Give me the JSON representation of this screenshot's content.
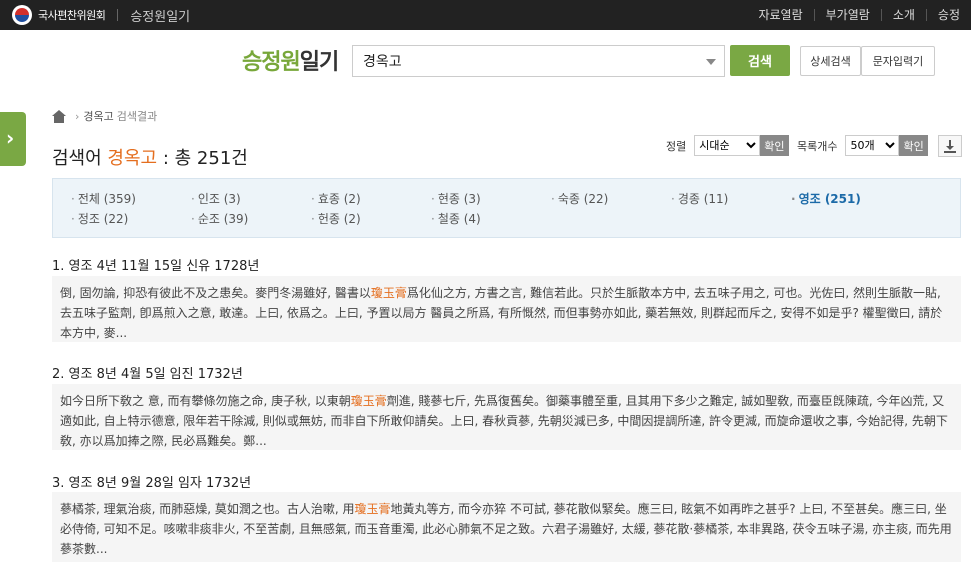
{
  "topbar": {
    "org": "국사편찬위원회",
    "app": "승정원일기",
    "links": [
      "자료열람",
      "부가열람",
      "소개",
      "승정"
    ]
  },
  "brand": {
    "green": "승정원",
    "dark": "일기"
  },
  "search": {
    "value": "경옥고",
    "button": "검색",
    "advanced": "상세검색",
    "char_input": "문자입력기"
  },
  "breadcrumb": {
    "keyword": "경옥고",
    "label": "검색결과"
  },
  "result_title": {
    "prefix": "검색어",
    "keyword": "경옥고",
    "suffix": ": 총 251건"
  },
  "controls": {
    "sort_label": "정렬",
    "sort_value": "시대순",
    "sort_ok": "확인",
    "count_label": "목록개수",
    "count_value": "50개",
    "count_ok": "확인"
  },
  "filters": [
    "전체 (359)",
    "인조 (3)",
    "효종 (2)",
    "현종 (3)",
    "숙종 (22)",
    "경종 (11)",
    "영조 (251)",
    "정조 (22)",
    "순조 (39)",
    "헌종 (2)",
    "철종 (4)"
  ],
  "results": [
    {
      "title": "1. 영조 4년 11월 15일  신유 1728년",
      "pre": "倒, 固勿論, 抑恐有彼此不及之患矣。麥門冬湯雖好, 醫書以",
      "kw": "瓊玉膏",
      "post": "爲化仙之方, 方書之言, 難信若此。只於生脈散本方中, 去五味子用之, 可也。光佐曰, 然則生脈散一貼, 去五味子監劑, 卽爲煎入之意, 敢達。上曰, 依爲之。上曰, 予置以局方 醫員之所爲, 有所慨然, 而但事勢亦如此, 藥若無效, 則群起而斥之, 安得不如是乎? 權聖徵曰, 請於本方中, 麥..."
    },
    {
      "title": "2. 영조 8년 4월 5일  임진 1732년",
      "pre": "如今日所下敎之 意, 而有攀條勿施之命, 庚子秋, 以東朝",
      "kw": "瓊玉膏",
      "post": "劑進, 賤蔘七斤, 先爲復舊矣。御藥事體至重, 且其用下多少之難定, 誠如聖敎, 而臺臣旣陳疏, 今年凶荒, 又適如此, 自上特示德意, 限年若干除減, 則似或無妨, 而非自下所敢仰請矣。上曰, 春秋貢蔘, 先朝災減已多, 中間因提調所達, 許令更減, 而旋命還收之事, 今始記得, 先朝下敎, 亦以爲加捧之際, 民必爲難矣。鄭..."
    },
    {
      "title": "3. 영조 8년 9월 28일  임자 1732년",
      "pre": "蔘橘茶, 理氣治痰, 而肺惡燥, 莫如潤之也。古人治嗽, 用",
      "kw": "瓊玉膏",
      "post": "地黃丸等方, 而今亦猝 不可試, 蔘花散似緊矣。應三曰, 眩氣不如再昨之甚乎? 上曰, 不至甚矣。應三曰, 坐必侍倚, 可知不足。咳嗽非痰非火, 不至苦劇, 且無感氣, 而玉音重濁, 此必心肺氣不足之致。六君子湯雖好, 太緩, 蔘花散·蔘橘茶, 本非異路, 茯令五味子湯, 亦主痰, 而先用蔘茶數..."
    }
  ]
}
